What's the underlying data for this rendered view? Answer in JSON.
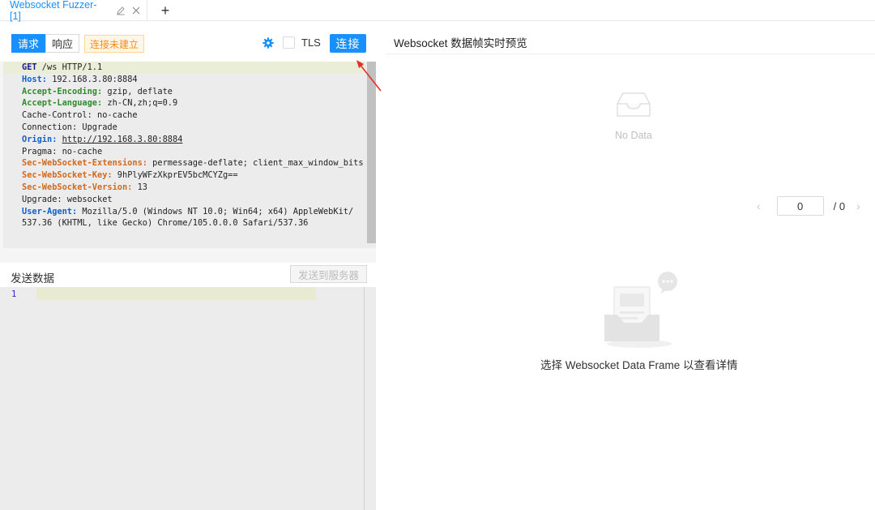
{
  "tab": {
    "title": "Websocket Fuzzer-[1]",
    "add_label": "+"
  },
  "request_panel": {
    "tab_request": "请求",
    "tab_response": "响应",
    "status_tag": "连接未建立",
    "tls_label": "TLS",
    "tls_checked": false,
    "connect_label": "连接",
    "lines": [
      {
        "key": "GET",
        "value": " /ws HTTP/1.1",
        "style": "navy"
      },
      {
        "key": "Host:",
        "value": " 192.168.3.80:8884",
        "style": "blue"
      },
      {
        "key": "Accept-Encoding:",
        "value": " gzip, deflate",
        "style": "green"
      },
      {
        "key": "Accept-Language:",
        "value": " zh-CN,zh;q=0.9",
        "style": "green"
      },
      {
        "key": "",
        "value": "Cache-Control: no-cache",
        "style": "plain"
      },
      {
        "key": "",
        "value": "Connection: Upgrade",
        "style": "plain"
      },
      {
        "key": "Origin:",
        "value": "http://192.168.3.80:8884",
        "style": "blue-link"
      },
      {
        "key": "",
        "value": "Pragma: no-cache",
        "style": "plain"
      },
      {
        "key": "Sec-WebSocket-Extensions:",
        "value": " permessage-deflate; client_max_window_bits",
        "style": "orange"
      },
      {
        "key": "Sec-WebSocket-Key:",
        "value": " 9hPlyWFzXkprEV5bcMCYZg==",
        "style": "orange"
      },
      {
        "key": "Sec-WebSocket-Version:",
        "value": " 13",
        "style": "orange"
      },
      {
        "key": "",
        "value": "Upgrade: websocket",
        "style": "plain"
      },
      {
        "key": "User-Agent:",
        "value": " Mozilla/5.0 (Windows NT 10.0; Win64; x64) AppleWebKit/",
        "style": "blue"
      },
      {
        "key": "",
        "value": "537.36 (KHTML, like Gecko) Chrome/105.0.0.0 Safari/537.36",
        "style": "plain"
      }
    ]
  },
  "send_panel": {
    "title": "发送数据",
    "send_button": "发送到服务器",
    "line_number": "1"
  },
  "preview_panel": {
    "title": "Websocket 数据帧实时预览",
    "empty_text": "No Data",
    "page_current": "0",
    "page_total": "/ 0",
    "detail_hint": "选择 Websocket Data Frame 以查看详情"
  },
  "colors": {
    "accent": "#1890ff",
    "warning": "#fa8c16",
    "arrow": "#e0322b"
  }
}
